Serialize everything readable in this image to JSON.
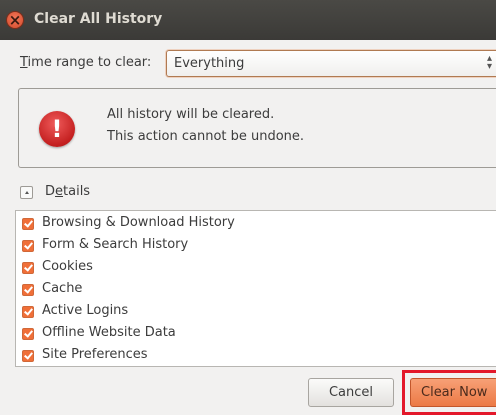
{
  "window": {
    "title": "Clear All History"
  },
  "time_range": {
    "label_underlined": "T",
    "label_rest": "ime range to clear:",
    "selected": "Everything"
  },
  "warning": {
    "line1": "All history will be cleared.",
    "line2": "This action cannot be undone."
  },
  "details": {
    "label_first": "D",
    "label_underlined": "e",
    "label_rest": "tails",
    "expanded": true
  },
  "items": [
    {
      "label": "Browsing & Download History",
      "checked": true
    },
    {
      "label": "Form & Search History",
      "checked": true
    },
    {
      "label": "Cookies",
      "checked": true
    },
    {
      "label": "Cache",
      "checked": true
    },
    {
      "label": "Active Logins",
      "checked": true
    },
    {
      "label": "Offline Website Data",
      "checked": true
    },
    {
      "label": "Site Preferences",
      "checked": true
    }
  ],
  "buttons": {
    "cancel": "Cancel",
    "clear_now": "Clear Now"
  },
  "colors": {
    "accent": "#f06f38",
    "highlight": "#e3182a",
    "titlebar": "#3b3a37",
    "warning": "#c42020"
  }
}
